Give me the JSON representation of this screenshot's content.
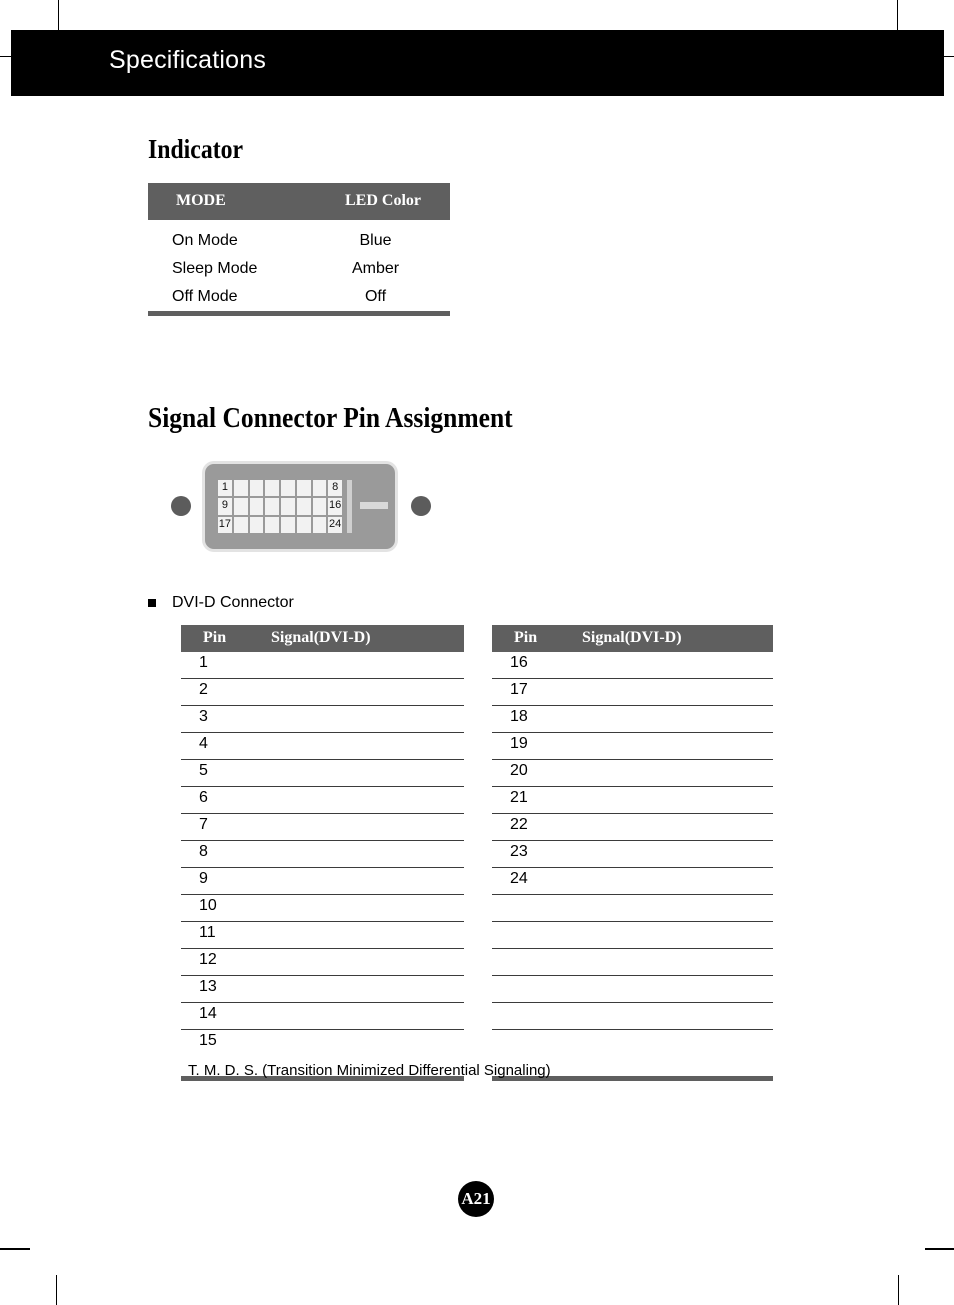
{
  "page": {
    "badge": "A21",
    "header_title": "Specifications"
  },
  "indicator": {
    "heading": "Indicator",
    "columns": [
      "MODE",
      "LED Color"
    ],
    "rows": [
      {
        "mode": "On Mode",
        "led": "Blue"
      },
      {
        "mode": "Sleep Mode",
        "led": "Amber"
      },
      {
        "mode": "Off Mode",
        "led": "Off"
      }
    ]
  },
  "connector": {
    "heading": "Signal Connector Pin Assignment",
    "bullet_label": "DVI-D Connector",
    "diagram": {
      "rows": 3,
      "cols": 8,
      "labeled_pins": {
        "r0c0": "1",
        "r0c7": "8",
        "r1c0": "9",
        "r1c7": "16",
        "r2c0": "17",
        "r2c7": "24"
      }
    },
    "table_columns": [
      "Pin",
      "Signal(DVI-D)"
    ],
    "left_rows": [
      {
        "pin": "1",
        "signal": ""
      },
      {
        "pin": "2",
        "signal": ""
      },
      {
        "pin": "3",
        "signal": ""
      },
      {
        "pin": "4",
        "signal": ""
      },
      {
        "pin": "5",
        "signal": ""
      },
      {
        "pin": "6",
        "signal": ""
      },
      {
        "pin": "7",
        "signal": ""
      },
      {
        "pin": "8",
        "signal": ""
      },
      {
        "pin": "9",
        "signal": ""
      },
      {
        "pin": "10",
        "signal": ""
      },
      {
        "pin": "11",
        "signal": ""
      },
      {
        "pin": "12",
        "signal": ""
      },
      {
        "pin": "13",
        "signal": ""
      },
      {
        "pin": "14",
        "signal": ""
      },
      {
        "pin": "15",
        "signal": ""
      }
    ],
    "right_rows": [
      {
        "pin": "16",
        "signal": ""
      },
      {
        "pin": "17",
        "signal": ""
      },
      {
        "pin": "18",
        "signal": ""
      },
      {
        "pin": "19",
        "signal": ""
      },
      {
        "pin": "20",
        "signal": ""
      },
      {
        "pin": "21",
        "signal": ""
      },
      {
        "pin": "22",
        "signal": ""
      },
      {
        "pin": "23",
        "signal": ""
      },
      {
        "pin": "24",
        "signal": ""
      },
      {
        "pin": "",
        "signal": ""
      },
      {
        "pin": "",
        "signal": ""
      },
      {
        "pin": "",
        "signal": ""
      },
      {
        "pin": "",
        "signal": ""
      },
      {
        "pin": "",
        "signal": ""
      },
      {
        "pin": "",
        "signal": ""
      }
    ],
    "footnote": "T. M. D. S. (Transition Minimized Differential Signaling)"
  },
  "colors": {
    "header_bar": "#000000",
    "table_header_gray": "#5f5f5f",
    "rule_gray": "#5f5f5f",
    "connector_body": "#9a9a9a",
    "connector_outline": "#e3e3e3",
    "pin_cell": "#f2f2f2",
    "screw": "#5c5c5c"
  }
}
